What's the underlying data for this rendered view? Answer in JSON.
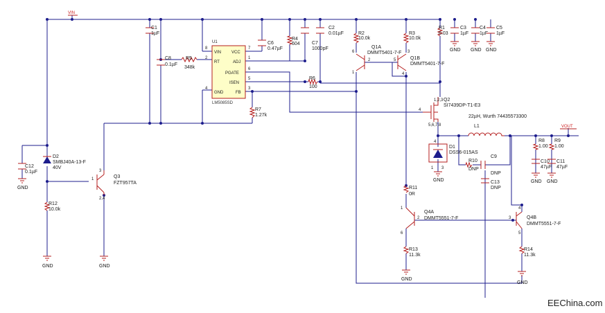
{
  "rails": {
    "vin": "VIN",
    "vout": "VOUT"
  },
  "watermark": "EEChina.com",
  "ic": {
    "ref": "U1",
    "part": "LM5085SD",
    "left_pins": [
      {
        "num": "8",
        "name": "VIN"
      },
      {
        "num": "2",
        "name": "RT"
      },
      {
        "num": "4",
        "name": "GND"
      }
    ],
    "right_pins": [
      {
        "num": "7",
        "name": "VCC"
      },
      {
        "num": "1",
        "name": "ADJ"
      },
      {
        "num": "6",
        "name": "PGATE"
      },
      {
        "num": "5",
        "name": "ISEN"
      },
      {
        "num": "3",
        "name": "FB"
      }
    ]
  },
  "components": {
    "c1": {
      "ref": "C1",
      "value": "1µF"
    },
    "c8": {
      "ref": "C8",
      "value": "0.1µF"
    },
    "r5": {
      "ref": "R5",
      "value": "348k"
    },
    "c6": {
      "ref": "C6",
      "value": "0.47µF"
    },
    "r4": {
      "ref": "R4",
      "value": "604"
    },
    "c7": {
      "ref": "C7",
      "value": "1000pF"
    },
    "c2": {
      "ref": "C2",
      "value": "0.01µF"
    },
    "r6": {
      "ref": "R6",
      "value": "100"
    },
    "r7": {
      "ref": "R7",
      "value": "1.27k"
    },
    "r2": {
      "ref": "R2",
      "value": "10.0k"
    },
    "r3": {
      "ref": "R3",
      "value": "10.0k"
    },
    "q1a": {
      "ref": "Q1A",
      "value": "DMMT5401-7-F"
    },
    "q1b": {
      "ref": "Q1B",
      "value": "DMMT5401-7-F"
    },
    "r1": {
      "ref": "R1",
      "value": "0.03"
    },
    "c3": {
      "ref": "C3",
      "value": "1µF"
    },
    "c4": {
      "ref": "C4",
      "value": "1µF"
    },
    "c5": {
      "ref": "C5",
      "value": "1µF"
    },
    "q2": {
      "ref": "Q2",
      "value": "SI7439DP-T1-E3"
    },
    "l1": {
      "ref": "L1",
      "value": "22µH, Wurth 74435573300"
    },
    "d1": {
      "ref": "D1",
      "value": "DSS6-015AS"
    },
    "r10": {
      "ref": "R10",
      "value": "DNP"
    },
    "c9": {
      "ref": "C9",
      "value": "DNP"
    },
    "c13": {
      "ref": "C13",
      "value": "DNP"
    },
    "r8": {
      "ref": "R8",
      "value": "1.00"
    },
    "r9": {
      "ref": "R9",
      "value": "1.00"
    },
    "c10": {
      "ref": "C10",
      "value": "47µF"
    },
    "c11": {
      "ref": "C11",
      "value": "47µF"
    },
    "d2": {
      "ref": "D2",
      "value": "SMBJ40A-13-F",
      "value2": "40V"
    },
    "c12": {
      "ref": "C12",
      "value": "0.1µF"
    },
    "r12": {
      "ref": "R12",
      "value": "10.0k"
    },
    "q3": {
      "ref": "Q3",
      "value": "FZT957TA"
    },
    "r11": {
      "ref": "R11",
      "value": "0R"
    },
    "q4a": {
      "ref": "Q4A",
      "value": "DMMT5551-7-F"
    },
    "q4b": {
      "ref": "Q4B",
      "value": "DMMT5551-7-F"
    },
    "r13": {
      "ref": "R13",
      "value": "11.3k"
    },
    "r14": {
      "ref": "R14",
      "value": "11.3k"
    }
  },
  "gnd_label": "GND"
}
